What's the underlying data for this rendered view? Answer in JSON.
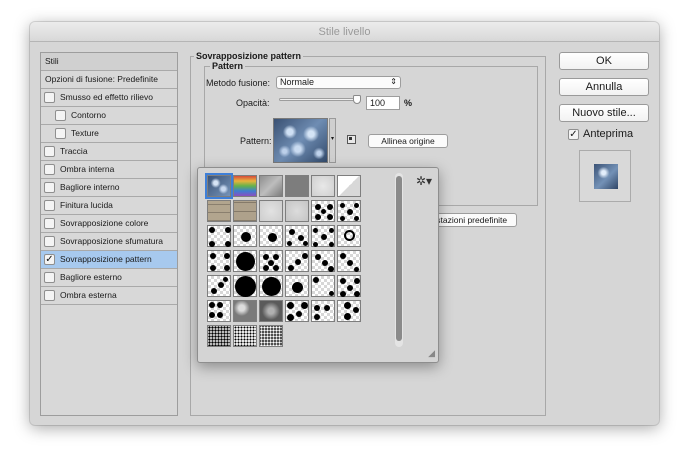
{
  "window": {
    "title": "Stile livello"
  },
  "sidebar": {
    "header": "Stili",
    "items": [
      {
        "label": "Opzioni di fusione: Predefinite",
        "checkbox": false,
        "checked": false,
        "indent": false,
        "selected": false
      },
      {
        "label": "Smusso ed effetto rilievo",
        "checkbox": true,
        "checked": false,
        "indent": false,
        "selected": false
      },
      {
        "label": "Contorno",
        "checkbox": true,
        "checked": false,
        "indent": true,
        "selected": false
      },
      {
        "label": "Texture",
        "checkbox": true,
        "checked": false,
        "indent": true,
        "selected": false
      },
      {
        "label": "Traccia",
        "checkbox": true,
        "checked": false,
        "indent": false,
        "selected": false
      },
      {
        "label": "Ombra interna",
        "checkbox": true,
        "checked": false,
        "indent": false,
        "selected": false
      },
      {
        "label": "Bagliore interno",
        "checkbox": true,
        "checked": false,
        "indent": false,
        "selected": false
      },
      {
        "label": "Finitura lucida",
        "checkbox": true,
        "checked": false,
        "indent": false,
        "selected": false
      },
      {
        "label": "Sovrapposizione colore",
        "checkbox": true,
        "checked": false,
        "indent": false,
        "selected": false
      },
      {
        "label": "Sovrapposizione sfumatura",
        "checkbox": true,
        "checked": false,
        "indent": false,
        "selected": false
      },
      {
        "label": "Sovrapposizione pattern",
        "checkbox": true,
        "checked": true,
        "indent": false,
        "selected": true
      },
      {
        "label": "Bagliore esterno",
        "checkbox": true,
        "checked": false,
        "indent": false,
        "selected": false
      },
      {
        "label": "Ombra esterna",
        "checkbox": true,
        "checked": false,
        "indent": false,
        "selected": false
      }
    ]
  },
  "panel": {
    "title": "Sovrapposizione pattern",
    "group_title": "Pattern",
    "blend_label": "Metodo fusione:",
    "blend_value": "Normale",
    "opacity_label": "Opacità:",
    "opacity_value": "100",
    "opacity_unit": "%",
    "opacity_fraction": 1.0,
    "pattern_label": "Pattern:",
    "snap_origin_button": "Allinea origine",
    "defaults_button": "impostazioni predefinite"
  },
  "buttons": {
    "ok": "OK",
    "cancel": "Annulla",
    "new_style": "Nuovo stile...",
    "preview_label": "Anteprima",
    "preview_checked": true
  },
  "picker": {
    "gear_icon": "gear-icon",
    "columns": 6,
    "tiles": [
      "bubbles",
      "rainbow-gradient",
      "gray-metal",
      "gray-dark",
      "gray-noise",
      "gradient-corner",
      "stone-tiles",
      "stone-tiles-2",
      "gray-texture",
      "gray-texture-2",
      "dots-quad",
      "dots-quad-2",
      "dots-corner",
      "dots-center",
      "dots-center-2",
      "dots-mixed",
      "dots-quad-3",
      "ring-star",
      "star-lines",
      "big-dot",
      "dots-cluster",
      "dots-diagonal",
      "dots-diagonal-2",
      "dots-diagonal-3",
      "dots-diagonal-4",
      "big-dot-2",
      "big-dot-3",
      "dots-center-3",
      "dots-sparse",
      "dots-quad-4",
      "dots-row",
      "mixed-sphere",
      "sphere-gray",
      "dots-corner-2",
      "dots-pair",
      "dots-stack",
      "speckle",
      "speckle-fine",
      "speckle-dark"
    ]
  }
}
